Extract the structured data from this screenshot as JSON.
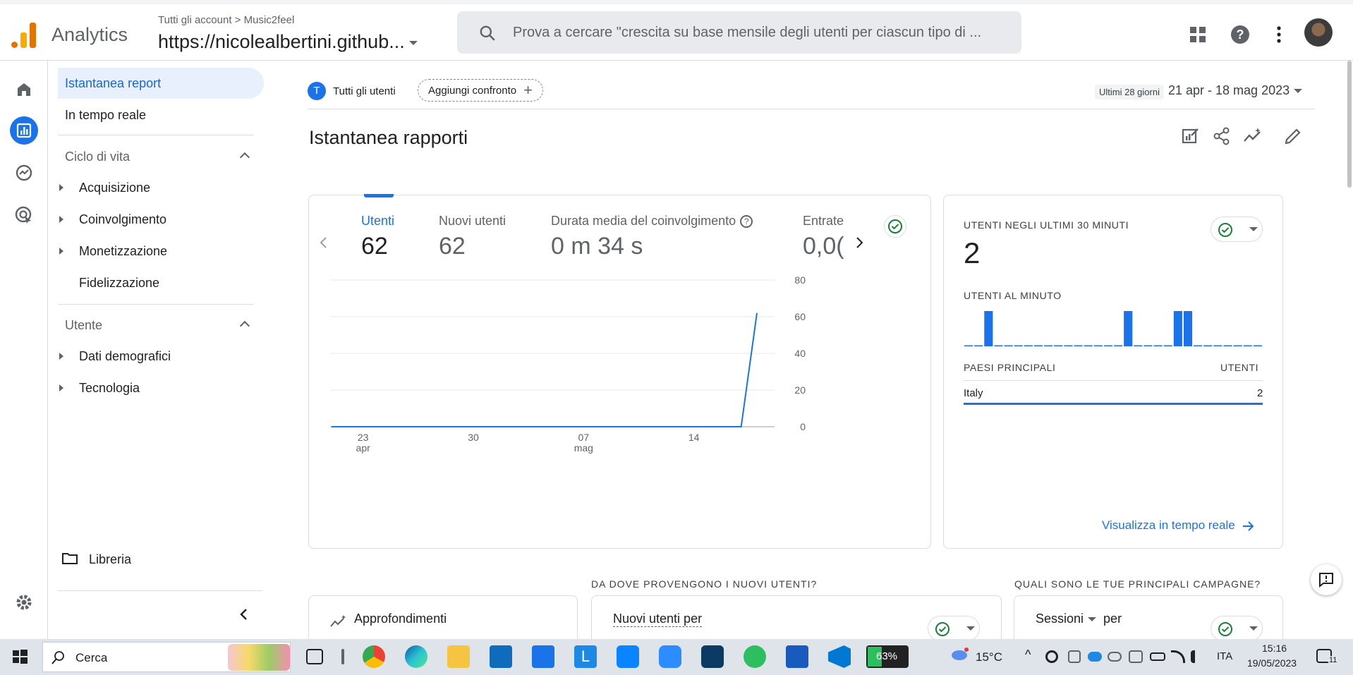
{
  "header": {
    "app_name": "Analytics",
    "breadcrumb_account": "Tutti gli account",
    "breadcrumb_sep": ">",
    "breadcrumb_property": "Music2feel",
    "property_name": "https://nicolealbertini.github...",
    "search_placeholder": "Prova a cercare \"crescita su base mensile degli utenti per ciascun tipo di ...",
    "icons": [
      "apps-grid-icon",
      "help-icon",
      "more-vert-icon",
      "account-avatar"
    ]
  },
  "rail": [
    "home-icon",
    "reports-icon",
    "explore-icon",
    "advertising-icon",
    "settings-icon"
  ],
  "nav": {
    "active": "Istantanea report",
    "realtime": "In tempo reale",
    "section_lifecycle": "Ciclo di vita",
    "lifecycle_items": [
      "Acquisizione",
      "Coinvolgimento",
      "Monetizzazione",
      "Fidelizzazione"
    ],
    "section_user": "Utente",
    "user_items": [
      "Dati demografici",
      "Tecnologia"
    ],
    "library": "Libreria"
  },
  "toolbar": {
    "segment_letter": "T",
    "segment_label": "Tutti gli utenti",
    "add_compare": "Aggiungi confronto",
    "range_label": "Ultimi 28 giorni",
    "range_value": "21 apr - 18 mag 2023"
  },
  "page_title": "Istantanea rapporti",
  "metrics": [
    {
      "label": "Utenti",
      "value": "62"
    },
    {
      "label": "Nuovi utenti",
      "value": "62"
    },
    {
      "label": "Durata media del coinvolgimento",
      "value": "0 m 34 s"
    },
    {
      "label": "Entrate",
      "value": "0,0("
    }
  ],
  "chart_data": {
    "type": "line",
    "x_ticks": [
      {
        "day": "23",
        "month": "apr"
      },
      {
        "day": "30",
        "month": ""
      },
      {
        "day": "07",
        "month": "mag"
      },
      {
        "day": "14",
        "month": ""
      }
    ],
    "y_ticks": [
      "80",
      "60",
      "40",
      "20",
      "0"
    ],
    "ylim": [
      0,
      80
    ],
    "series": [
      {
        "color": "#1a73e8",
        "x": [
          "21 apr",
          "22 apr",
          "23 apr",
          "24 apr",
          "25 apr",
          "26 apr",
          "27 apr",
          "28 apr",
          "29 apr",
          "30 apr",
          "1 mag",
          "2 mag",
          "3 mag",
          "4 mag",
          "5 mag",
          "6 mag",
          "7 mag",
          "8 mag",
          "9 mag",
          "10 mag",
          "11 mag",
          "12 mag",
          "13 mag",
          "14 mag",
          "15 mag",
          "16 mag",
          "17 mag",
          "18 mag"
        ],
        "values": [
          0,
          0,
          0,
          0,
          0,
          0,
          0,
          0,
          0,
          0,
          0,
          0,
          0,
          0,
          0,
          0,
          0,
          0,
          0,
          0,
          0,
          0,
          0,
          0,
          0,
          0,
          0,
          62
        ]
      }
    ]
  },
  "realtime": {
    "title": "UTENTI NEGLI ULTIMI 30 MINUTI",
    "value": "2",
    "per_minute_title": "UTENTI AL MINUTO",
    "per_minute": [
      0,
      0,
      1,
      0,
      0,
      0,
      0,
      0,
      0,
      0,
      0,
      0,
      0,
      0,
      0,
      0,
      1,
      0,
      0,
      0,
      0,
      1,
      1,
      0,
      0,
      0,
      0,
      0,
      0,
      0
    ],
    "bar_color": "#1a73e8",
    "table_col1": "PAESI PRINCIPALI",
    "table_col2": "UTENTI",
    "rows": [
      {
        "country": "Italy",
        "users": "2"
      }
    ],
    "link": "Visualizza in tempo reale"
  },
  "bottom": {
    "insights": "Approfondimenti",
    "q1": "DA DOVE PROVENGONO I NUOVI UTENTI?",
    "q1_card": "Nuovi utenti per",
    "q2": "QUALI SONO LE TUE PRINCIPALI CAMPAGNE?",
    "q2_card_a": "Sessioni",
    "q2_card_b": "per"
  },
  "taskbar": {
    "search": "Cerca",
    "battery": "63%",
    "weather": "15°C",
    "lang": "ITA",
    "time": "15:16",
    "date": "19/05/2023",
    "notif_count": "11"
  }
}
